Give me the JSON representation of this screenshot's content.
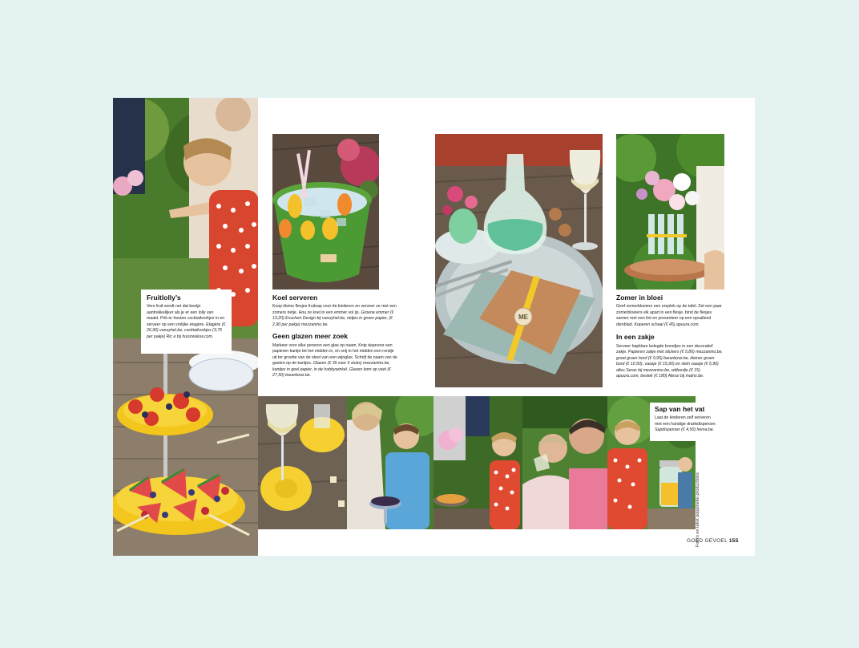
{
  "sections": {
    "fruitlolly": {
      "title": "Fruitlolly’s",
      "body": "Vers fruit wordt net dat beetje aantrekkelijker als je er een lolly van maakt. Prik er houten cocktailvorkjes in en serveer op een vrolijke etagère.",
      "details": "Etagère (€ 26,90) vanuyhel.be, cocktailvorkjes (3,75 per pakje) Ric e bij huiszwaluw.com."
    },
    "koel": {
      "title": "Koel serveren",
      "body": "Koop kleine flesjes fruitsap voor de kinderen en serveer ze met een zomers rietje. Hou ze koel in een emmer vol ijs.",
      "details": "Groene emmer (€ 13,20) Esschert Design bij vanuyhel.be, rietjes in groen papier, (€ 2,90 per pakje) mezzanino.be."
    },
    "glazen": {
      "title": "Geen glazen meer zoek",
      "body": "Markeer voor elke persoon een glas op naam. Knip daarvoor een papieren kantje tot het midden in, en snij in het midden een rondje uit ter grootte van de steel van een wijnglas. Schrijf de naam van de gasten op de kantjes.",
      "details": "Glazen (€ 35 voor 6 stuks) mezzanino.be, kantjes in geel papier, in de hobbywinkel. Glazen kom op voet (€ 27,50) bararbizar.be."
    },
    "zomer": {
      "title": "Zomer in bloei",
      "body": "Geef zomerbloeiers een ereplek op de tafel. Zet een paar zomerbloeiers elk apart in een flesje, bind de flesjes samen met een lint en presenteer op een opvallend dienblad.",
      "details": "Koperen schaal (€ 45) apuura.com."
    },
    "zakje": {
      "title": "In een zakje",
      "body": "Serveer hapklare belegde broodjes in een decoratief zakje.",
      "details": "Papieren zakje met stickers (€ 5,80) mezzanino.be, groot groen bord (€ 9,95) bararbizar.be, kleiner groen bord (€ 10,50), vaasje (€ 15,90) en slein vaasje (€ 5,90) alles Serax bij mezzanino.be, witbordje (€ 15) apuura.com, bestek (€ 180) Alessi bij matrix.be."
    },
    "sap": {
      "title": "Sap van het vat",
      "body": "Laat de kinderen zelf serveren met een handige drankdispenser.",
      "details": "Sapdispenser (€ 4,50) hema.be."
    }
  },
  "credit": "Foto’s en tekst poppinette productions",
  "folio": {
    "magazine": "GOED GEVOEL",
    "page": "155"
  },
  "tag_text": "ME",
  "colors": {
    "background": "#e4f2f2",
    "page": "#ffffff"
  }
}
